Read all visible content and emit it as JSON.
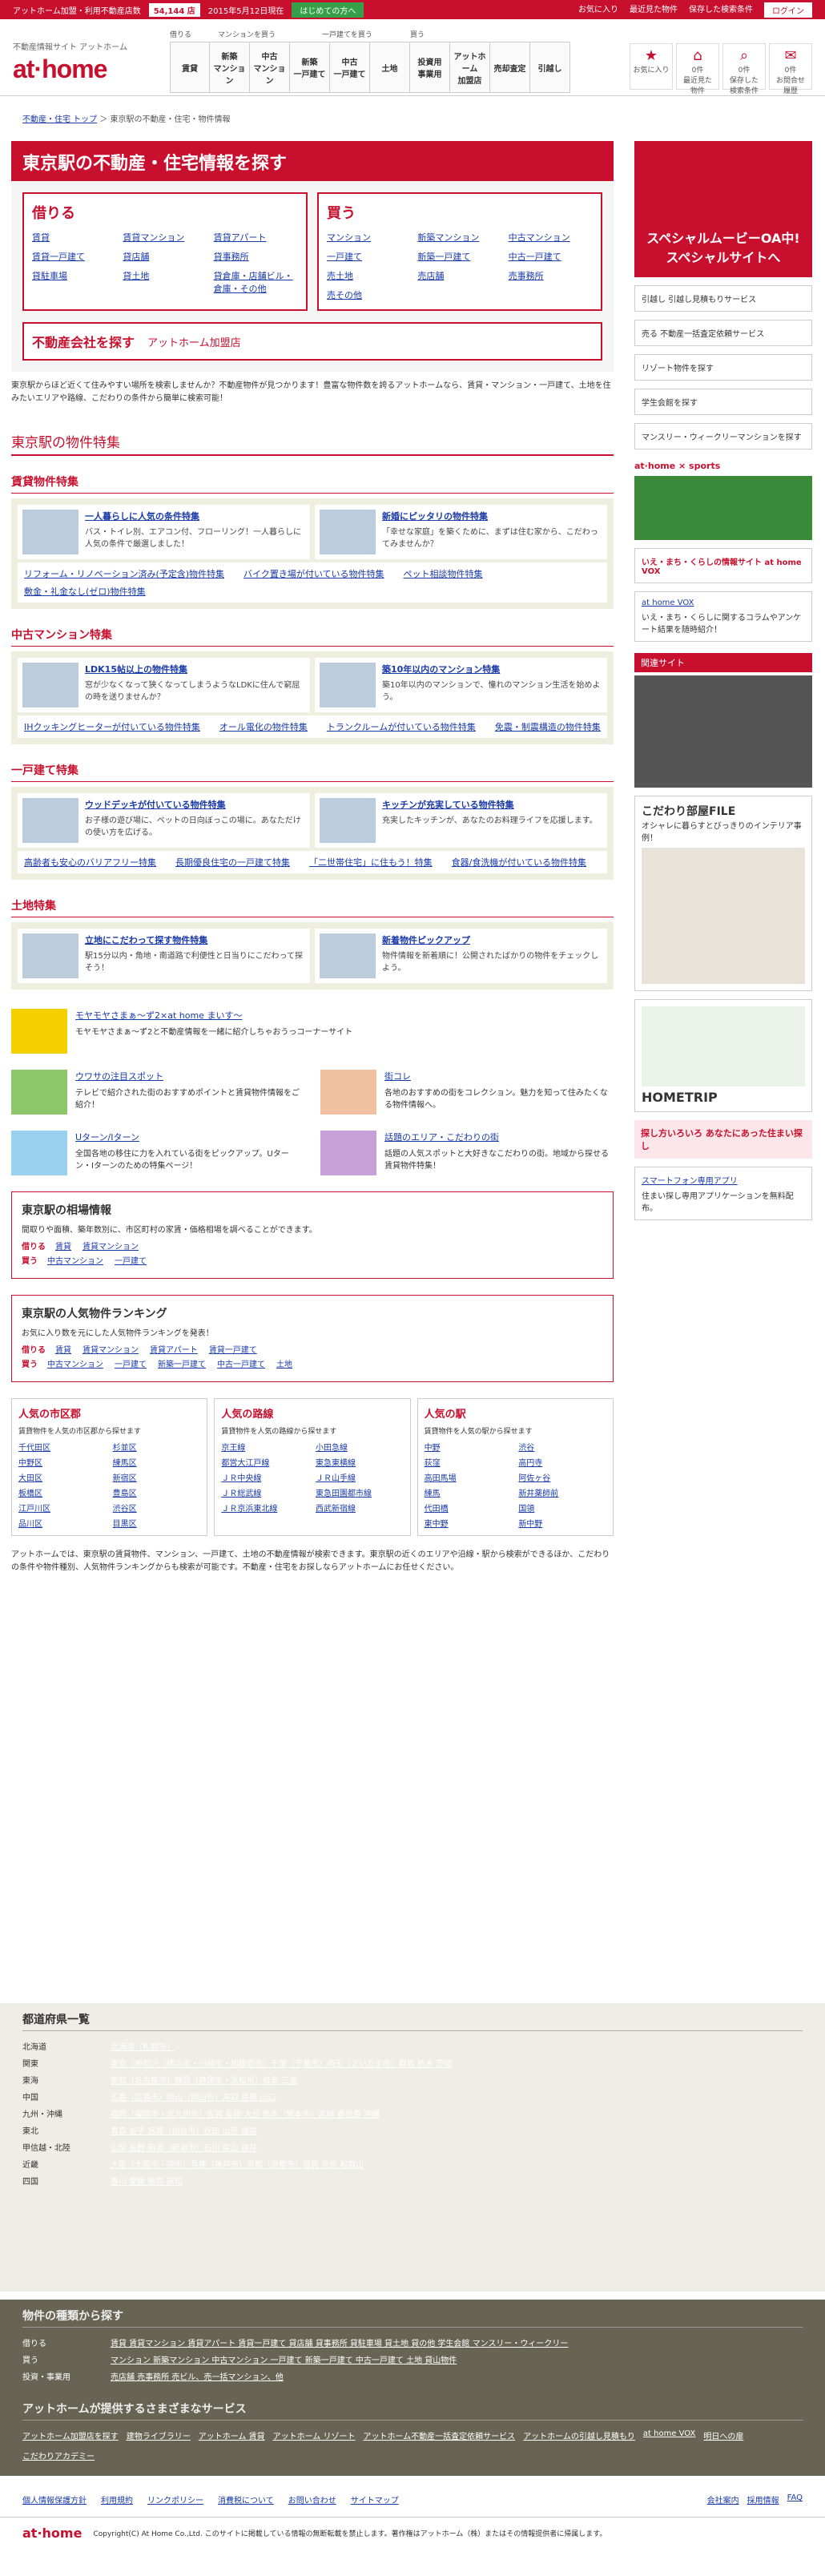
{
  "topbar": {
    "left": "アットホーム加盟・利用不動産店数",
    "count": "54,144 店",
    "date": "2015年5月12日現在",
    "start": "はじめての方へ",
    "fav": "お気に入り",
    "recent": "最近見た物件",
    "saved": "保存した検索条件",
    "login": "ログイン"
  },
  "header": {
    "tagline": "不動産情報サイト アットホーム",
    "logo": "at·home",
    "groups": [
      "借りる",
      "マンションを買う",
      "一戸建てを買う",
      "買う"
    ],
    "nav": [
      "賃貸",
      "新築\nマンション",
      "中古\nマンション",
      "新築\n一戸建て",
      "中古\n一戸建て",
      "土地",
      "投資用\n事業用",
      "アットホーム\n加盟店",
      "売却査定",
      "引越し"
    ],
    "icons": [
      {
        "icon": "star-icon",
        "num": "",
        "label": "お気に入り"
      },
      {
        "icon": "house-icon",
        "num": "0件",
        "label": "最近見た\n物件"
      },
      {
        "icon": "search-icon",
        "num": "0件",
        "label": "保存した\n検索条件"
      },
      {
        "icon": "bag-icon",
        "num": "0件",
        "label": "お問合せ\n履歴"
      }
    ]
  },
  "breadcrumb": {
    "home": "不動産・住宅 トップ",
    "current": "東京駅の不動産・住宅・物件情報"
  },
  "title": "東京駅の不動産・住宅情報を探す",
  "rent": {
    "title": "借りる",
    "links": [
      "賃貸",
      "賃貸マンション",
      "賃貸アパート",
      "賃貸一戸建て",
      "貸店舗",
      "貸事務所",
      "貸駐車場",
      "貸土地",
      "貸倉庫・店舗ビル・倉庫・その他"
    ]
  },
  "buy": {
    "title": "買う",
    "links": [
      "マンション",
      "新築マンション",
      "中古マンション",
      "一戸建て",
      "新築一戸建て",
      "中古一戸建て",
      "売土地",
      "売店舗",
      "売事務所",
      "売その他"
    ]
  },
  "agent": {
    "title": "不動産会社を探す",
    "sub": "アットホーム加盟店"
  },
  "intro": "東京駅からほど近くて住みやすい場所を検索しませんか？不動産物件が見つかります！豊富な物件数を誇るアットホームなら、賃貸・マンション・一戸建て、土地を住みたいエリアや路線、こだわりの条件から簡単に検索可能！",
  "features": {
    "title": "東京駅の物件特集",
    "sections": [
      {
        "title": "賃貸物件特集",
        "items": [
          {
            "t": "一人暮らしに人気の条件特集",
            "d": "バス・トイレ別、エアコン付、フローリング！一人暮らしに人気の条件で厳選しました！"
          },
          {
            "t": "新婚にピッタリの物件特集",
            "d": "「幸せな家庭」を築くために、まずは住む家から、こだわってみませんか？"
          }
        ],
        "links": [
          "リフォーム・リノベーション済み(予定含)物件特集",
          "バイク置き場が付いている物件特集",
          "ペット相談物件特集",
          "敷金・礼金なし(ゼロ)物件特集"
        ]
      },
      {
        "title": "中古マンション特集",
        "items": [
          {
            "t": "LDK15帖以上の物件特集",
            "d": "窓が少なくなって狭くなってしまうようなLDKに住んで窮屈の時を送りませんか？"
          },
          {
            "t": "築10年以内のマンション特集",
            "d": "築10年以内のマンションで、憧れのマンション生活を始めよう。"
          }
        ],
        "links": [
          "IHクッキングヒーターが付いている物件特集",
          "オール電化の物件特集",
          "トランクルームが付いている物件特集",
          "免震・制震構造の物件特集"
        ]
      },
      {
        "title": "一戸建て特集",
        "items": [
          {
            "t": "ウッドデッキが付いている物件特集",
            "d": "お子様の遊び場に、ペットの日向ぼっこの場に。あなただけの使い方を広げる。"
          },
          {
            "t": "キッチンが充実している物件特集",
            "d": "充実したキッチンが、あなたのお料理ライフを応援します。"
          }
        ],
        "links": [
          "高齢者も安心のバリアフリー特集",
          "長期優良住宅の一戸建て特集",
          "「二世帯住宅」に住もう！特集",
          "食器/食洗機が付いている物件特集"
        ]
      },
      {
        "title": "土地特集",
        "items": [
          {
            "t": "立地にこだわって探す物件特集",
            "d": "駅15分以内・角地・南道路で利便性と日当りにこだわって探そう！"
          },
          {
            "t": "新着物件ピックアップ",
            "d": "物件情報を新着順に！公開されたばかりの物件をチェックしよう。"
          }
        ],
        "links": []
      }
    ]
  },
  "promos": [
    {
      "t": "モヤモヤさまぁ～ず2×at home まいす～",
      "d": "モヤモヤさまぁ～ず2と不動産情報を一緒に紹介しちゃおうっコーナーサイト"
    },
    {
      "t": "ウワサの注目スポット",
      "d": "テレビで紹介された街のおすすめポイントと賃貸物件情報をご紹介！"
    },
    {
      "t": "街コレ",
      "d": "各地のおすすめの街をコレクション。魅力を知って住みたくなる物件情報へ。"
    },
    {
      "t": "Uターン/Iターン",
      "d": "全国各地の移住に力を入れている街をピックアップ。Uターン・Iターンのための特集ページ！"
    },
    {
      "t": "話題のエリア・こだわりの街",
      "d": "話題の人気スポットと大好きなこだわりの街。地域から探せる賃貸物件特集！"
    }
  ],
  "market": {
    "title": "東京駅の相場情報",
    "desc": "間取りや面積、築年数別に、市区町村の家賃・価格相場を調べることができます。",
    "rent": "借りる",
    "buy": "買う",
    "rentLinks": [
      "賃貸",
      "賃貸マンション"
    ],
    "buyLinks": [
      "中古マンション",
      "一戸建て"
    ]
  },
  "ranking": {
    "title": "東京駅の人気物件ランキング",
    "desc": "お気に入り数を元にした人気物件ランキングを発表！",
    "rent": "借りる",
    "buy": "買う",
    "rentLinks": [
      "賃貸",
      "賃貸マンション",
      "賃貸アパート",
      "賃貸一戸建て"
    ],
    "buyLinks": [
      "中古マンション",
      "一戸建て",
      "新築一戸建て",
      "中古一戸建て",
      "土地"
    ]
  },
  "ranks": [
    {
      "title": "人気の市区郡",
      "sub": "賃貸物件を人気の市区郡から探せます",
      "items": [
        "千代田区",
        "杉並区",
        "中野区",
        "練馬区",
        "大田区",
        "新宿区",
        "板橋区",
        "豊島区",
        "江戸川区",
        "渋谷区",
        "品川区",
        "目黒区"
      ]
    },
    {
      "title": "人気の路線",
      "sub": "賃貸物件を人気の路線から探せます",
      "items": [
        "京王線",
        "小田急線",
        "都営大江戸線",
        "東急東横線",
        "ＪＲ中央線",
        "ＪＲ山手線",
        "ＪＲ総武線",
        "東急田園都市線",
        "ＪＲ京浜東北線",
        "西武新宿線"
      ]
    },
    {
      "title": "人気の駅",
      "sub": "賃貸物件を人気の駅から探せます",
      "items": [
        "中野",
        "渋谷",
        "荻窪",
        "高円寺",
        "高田馬場",
        "阿佐ヶ谷",
        "練馬",
        "新井薬師前",
        "代田橋",
        "国領",
        "東中野",
        "新中野"
      ]
    }
  ],
  "bottomtext": "アットホームでは、東京駅の賃貸物件、マンション、一戸建て、土地の不動産情報が検索できます。東京駅の近くのエリアや沿線・駅から検索ができるほか、こだわりの条件や物件種別、人気物件ランキングからも検索が可能です。不動産・住宅をお探しならアットホームにお任せください。",
  "pref": {
    "title": "都道府県一覧",
    "rows": [
      {
        "k": "北海道",
        "v": "北海道（札幌市）"
      },
      {
        "k": "関東",
        "v": "東京（神奈川（横浜市・川崎市・相模原市）千葉（千葉市）埼玉（さいたま市）群馬 栃木 茨城"
      },
      {
        "k": "東海",
        "v": "愛知（名古屋市）静岡（静岡市・浜松市）岐阜 三重"
      },
      {
        "k": "中国",
        "v": "広島（広島市）岡山（岡山市）鳥取 島根 山口"
      },
      {
        "k": "九州・沖縄",
        "v": "福岡（福岡市・北九州市）佐賀 長崎 大分 熊本（熊本市）宮崎 鹿児島 沖縄"
      },
      {
        "k": "東北",
        "v": "青森 岩手 宮城（仙台市）秋田 山形 福島"
      },
      {
        "k": "甲信越・北陸",
        "v": "山梨 長野 新潟（新潟市）石川 富山 福井"
      },
      {
        "k": "近畿",
        "v": "大阪（大阪市・堺市）兵庫（神戸市）京都（京都市）滋賀 奈良 和歌山"
      },
      {
        "k": "四国",
        "v": "香川 愛媛 徳島 高知"
      }
    ]
  },
  "types": {
    "title": "物件の種類から探す",
    "rows": [
      {
        "k": "借りる",
        "v": "賃貸 賃貸マンション 賃貸アパート 賃貸一戸建て 貸店舗 貸事務所 貸駐車場 貸土地 貸の他 学生会館 マンスリー・ウィークリー"
      },
      {
        "k": "買う",
        "v": "マンション 新築マンション 中古マンション 一戸建て 新築一戸建て 中古一戸建て 土地 貸山物件"
      },
      {
        "k": "投資・事業用",
        "v": "売店舗 売事務所 売ビル、売一括マンション、他"
      }
    ]
  },
  "services": {
    "title": "アットホームが提供するさまざまなサービス",
    "items": [
      "アットホーム加盟店を探す",
      "建物ライブラリー",
      "アットホーム 賃貸",
      "アットホーム リゾート",
      "アットホーム不動産一括査定依頼サービス",
      "アットホームの引越し見積もり",
      "at home VOX",
      "明日への扉",
      "こだわりアカデミー"
    ]
  },
  "footer": {
    "links": [
      "個人情報保護方針",
      "利用規約",
      "リンクポリシー",
      "消費税について",
      "お問い合わせ",
      "サイトマップ"
    ],
    "right": [
      "会社案内",
      "採用情報",
      "FAQ"
    ],
    "copy": "Copyright(C) At Home Co.,Ltd. このサイトに掲載している情報の無断転載を禁止します。著作権はアットホーム（株）またはその情報提供者に帰属します。",
    "logo": "at·home"
  },
  "sidebar": {
    "banner": "スペシャルムービーOA中!\nスペシャルサイトへ",
    "links": [
      "引越し 引越し見積もりサービス",
      "売る 不動産一括査定依頼サービス",
      "リゾート物件を探す",
      "学生会館を探す",
      "マンスリー・ウィークリーマンションを探す"
    ],
    "sports": "at·home × sports",
    "vox": "いえ・まち・くらしの情報サイト at home VOX",
    "related": "関連サイト",
    "vox2": "at home VOX",
    "vox2desc": "いえ・まち・くらしに関するコラムやアンケート結果を随時紹介！",
    "file": "こだわり部屋FILE",
    "file_d": "オシャレに暮らすとびっきりのインテリア事例！",
    "trip": "HOMETRIP",
    "smart": "探し方いろいろ あなたにあった住まい探し",
    "app": "スマートフォン専用アプリ",
    "app_d": "住まい探し専用アプリケーションを無料配布。"
  }
}
